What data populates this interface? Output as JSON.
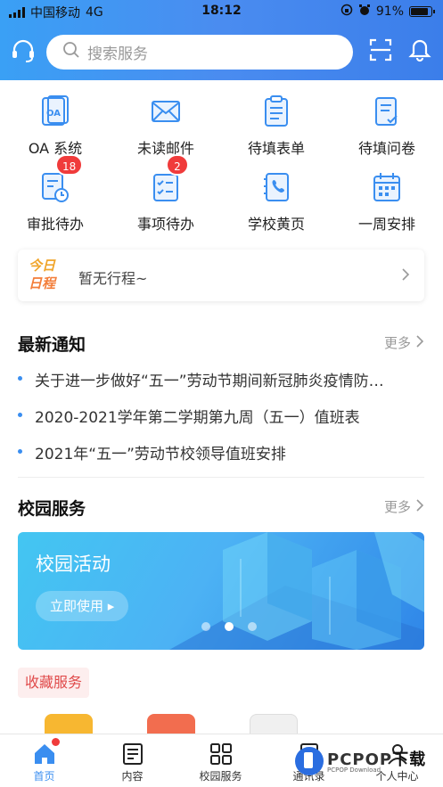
{
  "status_bar": {
    "carrier": "中国移动",
    "network": "4G",
    "time": "18:12",
    "battery": "91%"
  },
  "header": {
    "search_placeholder": "搜索服务"
  },
  "quick_grid": [
    {
      "label": "OA 系统",
      "icon": "oa-icon"
    },
    {
      "label": "未读邮件",
      "icon": "mail-icon"
    },
    {
      "label": "待填表单",
      "icon": "form-icon"
    },
    {
      "label": "待填问卷",
      "icon": "survey-icon"
    },
    {
      "label": "审批待办",
      "icon": "approval-icon",
      "badge": "18"
    },
    {
      "label": "事项待办",
      "icon": "todo-icon",
      "badge": "2"
    },
    {
      "label": "学校黄页",
      "icon": "phonebook-icon"
    },
    {
      "label": "一周安排",
      "icon": "calendar-icon"
    }
  ],
  "today_schedule": {
    "tag_line1": "今日",
    "tag_line2": "日程",
    "text": "暂无行程~"
  },
  "notices": {
    "title": "最新通知",
    "more": "更多",
    "items": [
      "关于进一步做好“五一”劳动节期间新冠肺炎疫情防…",
      "2020-2021学年第二学期第九周（五一）值班表",
      "2021年“五一”劳动节校领导值班安排"
    ]
  },
  "campus_services": {
    "title": "校园服务",
    "more": "更多",
    "banner_title": "校园活动",
    "banner_button": "立即使用 ▸",
    "active_slide": 2,
    "slide_count": 3
  },
  "favorites": {
    "label": "收藏服务"
  },
  "tabbar": [
    {
      "label": "首页",
      "icon": "home-icon",
      "active": true
    },
    {
      "label": "内容",
      "icon": "content-icon"
    },
    {
      "label": "校园服务",
      "icon": "grid-icon"
    },
    {
      "label": "通讯录",
      "icon": "contacts-icon"
    },
    {
      "label": "个人中心",
      "icon": "user-icon"
    }
  ],
  "watermark": {
    "brand": "PCPOP",
    "suffix": "下载",
    "sub": "PCPOP Download"
  },
  "colors": {
    "accent": "#3a8ef0",
    "badge": "#f03b3b",
    "header_start": "#3aa0f5",
    "header_end": "#3b7eea"
  }
}
